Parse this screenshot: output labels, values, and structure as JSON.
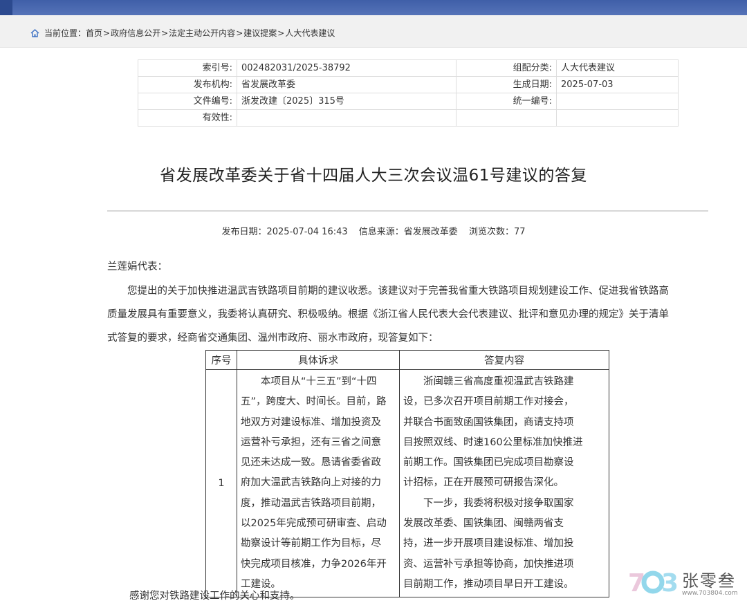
{
  "breadcrumb": {
    "prefix": "当前位置：",
    "items": [
      "首页",
      "政府信息公开",
      "法定主动公开内容",
      "建议提案",
      "人大代表建议"
    ],
    "separator": ">"
  },
  "meta": {
    "rows": [
      {
        "label1": "索引号:",
        "value1": "002482031/2025-38792",
        "label2": "组配分类:",
        "value2": "人大代表建议"
      },
      {
        "label1": "发布机构:",
        "value1": "省发展改革委",
        "label2": "生成日期:",
        "value2": "2025-07-03"
      },
      {
        "label1": "文件编号:",
        "value1": "浙发改建〔2025〕315号",
        "label2": "统一编号:",
        "value2": ""
      },
      {
        "label1": "有效性:",
        "value1": "",
        "label2": "",
        "value2": ""
      }
    ]
  },
  "article": {
    "title": "省发展改革委关于省十四届人大三次会议温61号建议的答复",
    "publish_label": "发布日期：",
    "publish_date": "2025-07-04 16:43",
    "source_label": "信息来源：",
    "source": "省发展改革委",
    "views_label": "浏览次数：",
    "views": "77",
    "salutation": "兰莲娟代表：",
    "intro_lines": [
      "您提出的关于加快推进温武吉铁路项目前期的建议收悉。该建议对于完善我省重大铁路项目规划建设工作、促进我省铁路高",
      "质量发展具有重要意义，我委将认真研究、积极吸纳。根据《浙江省人民代表大会代表建议、批评和意见办理的规定》关于清单",
      "式答复的要求，经商省交通集团、温州市政府、丽水市政府，现答复如下："
    ],
    "closing": "感谢您对铁路建设工作的关心和支持。"
  },
  "reply_table": {
    "headers": [
      "序号",
      "具体诉求",
      "答复内容"
    ],
    "rows": [
      {
        "no": "1",
        "request_lines": [
          {
            "text": "本项目从“十三五”到“十四",
            "indent": true
          },
          {
            "text": "五”，跨度大、时间长。目前，路",
            "indent": false
          },
          {
            "text": "地双方对建设标准、增加投资及",
            "indent": false
          },
          {
            "text": "运营补亏承担，还有三省之间意",
            "indent": false
          },
          {
            "text": "见还未达成一致。恳请省委省政",
            "indent": false
          },
          {
            "text": "府加大温武吉铁路向上对接的力",
            "indent": false
          },
          {
            "text": "度，推动温武吉铁路项目前期，",
            "indent": false
          },
          {
            "text": "以2025年完成预可研审查、启动",
            "indent": false
          },
          {
            "text": "勘察设计等前期工作为目标，尽",
            "indent": false
          },
          {
            "text": "快完成项目核准，力争2026年开",
            "indent": false
          },
          {
            "text": "工建设。",
            "indent": false
          }
        ],
        "reply_lines": [
          {
            "text": "浙闽赣三省高度重视温武吉铁路建",
            "indent": true
          },
          {
            "text": "设，已多次召开项目前期工作对接会，",
            "indent": false
          },
          {
            "text": "并联合书面致函国铁集团，商请支持项",
            "indent": false
          },
          {
            "text": "目按照双线、时速160公里标准加快推进",
            "indent": false
          },
          {
            "text": "前期工作。国铁集团已完成项目勘察设",
            "indent": false
          },
          {
            "text": "计招标，正在开展预可研报告深化。",
            "indent": false
          },
          {
            "text": "下一步，我委将积极对接争取国家",
            "indent": true
          },
          {
            "text": "发展改革委、国铁集团、闽赣两省支",
            "indent": false
          },
          {
            "text": "持，进一步开展项目建设标准、增加投",
            "indent": false
          },
          {
            "text": "资、运营补亏承担等协商，加快推进项",
            "indent": false
          },
          {
            "text": "目前期工作，推动项目早日开工建设。",
            "indent": false
          }
        ]
      }
    ]
  },
  "watermark": {
    "brand": "张零叁",
    "url": "www.703804.com",
    "logo_text": "703"
  },
  "colors": {
    "topbar": "#4a68b0",
    "crumbbar": "#f1f1f1",
    "text": "#333333"
  }
}
